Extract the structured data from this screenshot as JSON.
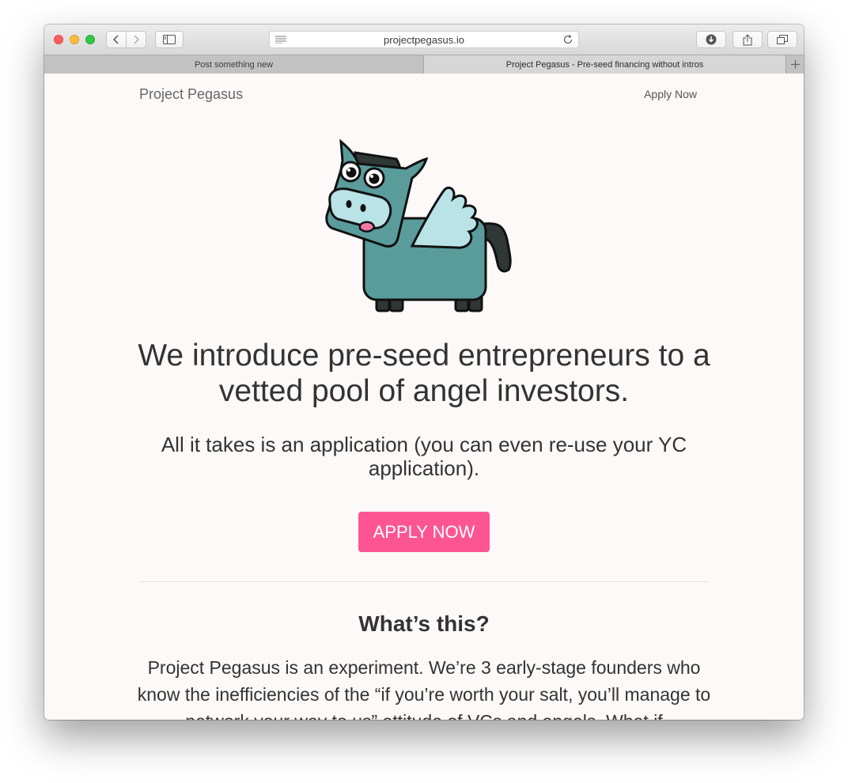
{
  "browser": {
    "url": "projectpegasus.io",
    "tabs": [
      {
        "label": "Post something new"
      },
      {
        "label": "Project Pegasus - Pre-seed financing without intros"
      }
    ]
  },
  "site": {
    "brand": "Project Pegasus",
    "nav_apply": "Apply Now",
    "hero_image": "pegasus-mascot-illustration",
    "headline": "We introduce pre-seed entrepreneurs to a vetted pool of angel investors.",
    "subhead": "All it takes is an application (you can even re-use your YC application).",
    "cta": "APPLY NOW",
    "section_title": "What’s this?",
    "section_body": "Project Pegasus is an experiment. We’re 3 early-stage founders who know the inefficiencies of the “if you’re worth your salt, you’ll manage to network your way to us” attitude of VCs and angels. What if"
  },
  "colors": {
    "accent": "#fd5592",
    "page_bg": "#fcf9f8",
    "text": "#333333",
    "mascot_body": "#5a9c9c",
    "mascot_wing": "#b9e3e6"
  }
}
